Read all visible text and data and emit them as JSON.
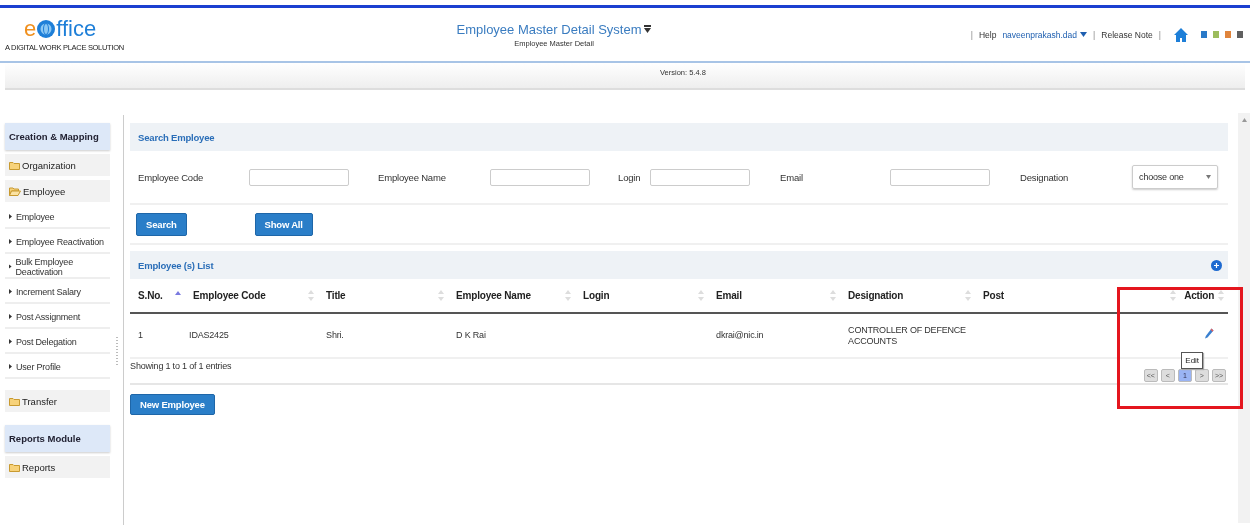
{
  "header": {
    "logo": [
      {
        "text": "e",
        "color": "#f0901e"
      },
      {
        "text": "ffice",
        "color": "#1e7fd8"
      }
    ],
    "tagline": "A DIGITAL WORK PLACE SOLUTION",
    "title": "Employee Master Detail System",
    "subtitle": "Employee Master Detail",
    "links": [
      {
        "kind": "separator",
        "label": "|"
      },
      {
        "kind": "text",
        "label": "Help"
      },
      {
        "kind": "user",
        "label": "naveenprakash.dad"
      },
      {
        "kind": "separator",
        "label": "|"
      },
      {
        "kind": "text",
        "label": "Release Note"
      },
      {
        "kind": "separator",
        "label": "|"
      }
    ],
    "themes": [
      {
        "color": "#2a7ac8"
      },
      {
        "color": "#9cbc5c"
      },
      {
        "color": "#e0843c"
      },
      {
        "color": "#606060"
      }
    ],
    "version": "Version: 5.4.8"
  },
  "sidebar": {
    "items": [
      {
        "kind": "section",
        "label": "Creation & Mapping"
      },
      {
        "kind": "folder",
        "label": "Organization",
        "expanded": false
      },
      {
        "kind": "folder",
        "label": "Employee",
        "expanded": true
      },
      {
        "kind": "item",
        "label": "Employee"
      },
      {
        "kind": "item",
        "label": "Employee Reactivation"
      },
      {
        "kind": "item",
        "label": "Bulk Employee Deactivation"
      },
      {
        "kind": "item",
        "label": "Increment Salary"
      },
      {
        "kind": "item",
        "label": "Post Assignment"
      },
      {
        "kind": "item",
        "label": "Post Delegation"
      },
      {
        "kind": "item",
        "label": "User Profile"
      },
      {
        "kind": "folder",
        "label": "Transfer",
        "expanded": false
      },
      {
        "kind": "section",
        "label": "Reports Module"
      },
      {
        "kind": "folder",
        "label": "Reports",
        "expanded": false
      }
    ]
  },
  "search": {
    "title": "Search Employee",
    "fields": [
      {
        "kind": "input",
        "label": "Employee Code"
      },
      {
        "kind": "input",
        "label": "Employee Name"
      },
      {
        "kind": "input",
        "label": "Login"
      },
      {
        "kind": "input",
        "label": "Email"
      },
      {
        "kind": "select",
        "label": "Designation",
        "value": "choose one"
      }
    ],
    "buttons": [
      "Search",
      "Show All"
    ]
  },
  "list": {
    "title": "Employee (s) List",
    "columns": [
      {
        "label": "S.No.",
        "sorted": true
      },
      {
        "label": "Employee Code",
        "sorted": false
      },
      {
        "label": "Title",
        "sorted": false
      },
      {
        "label": "Employee Name",
        "sorted": false
      },
      {
        "label": "Login",
        "sorted": false
      },
      {
        "label": "Email",
        "sorted": false
      },
      {
        "label": "Designation",
        "sorted": false
      },
      {
        "label": "Post",
        "sorted": false
      },
      {
        "label": "Action",
        "sorted": false
      }
    ],
    "rows": [
      {
        "cells": [
          "1",
          "IDAS2425",
          "Shri.",
          "D K Rai",
          "",
          "dkrai@nic.in",
          "CONTROLLER OF DEFENCE ACCOUNTS",
          ""
        ]
      }
    ],
    "info": "Showing 1 to 1 of 1 entries",
    "pages": [
      {
        "label": "<<",
        "selected": false
      },
      {
        "label": "<",
        "selected": false
      },
      {
        "label": "1",
        "selected": true
      },
      {
        "label": ">",
        "selected": false
      },
      {
        "label": ">>",
        "selected": false
      }
    ],
    "tooltip": "Edit"
  },
  "new_button": "New Employee"
}
